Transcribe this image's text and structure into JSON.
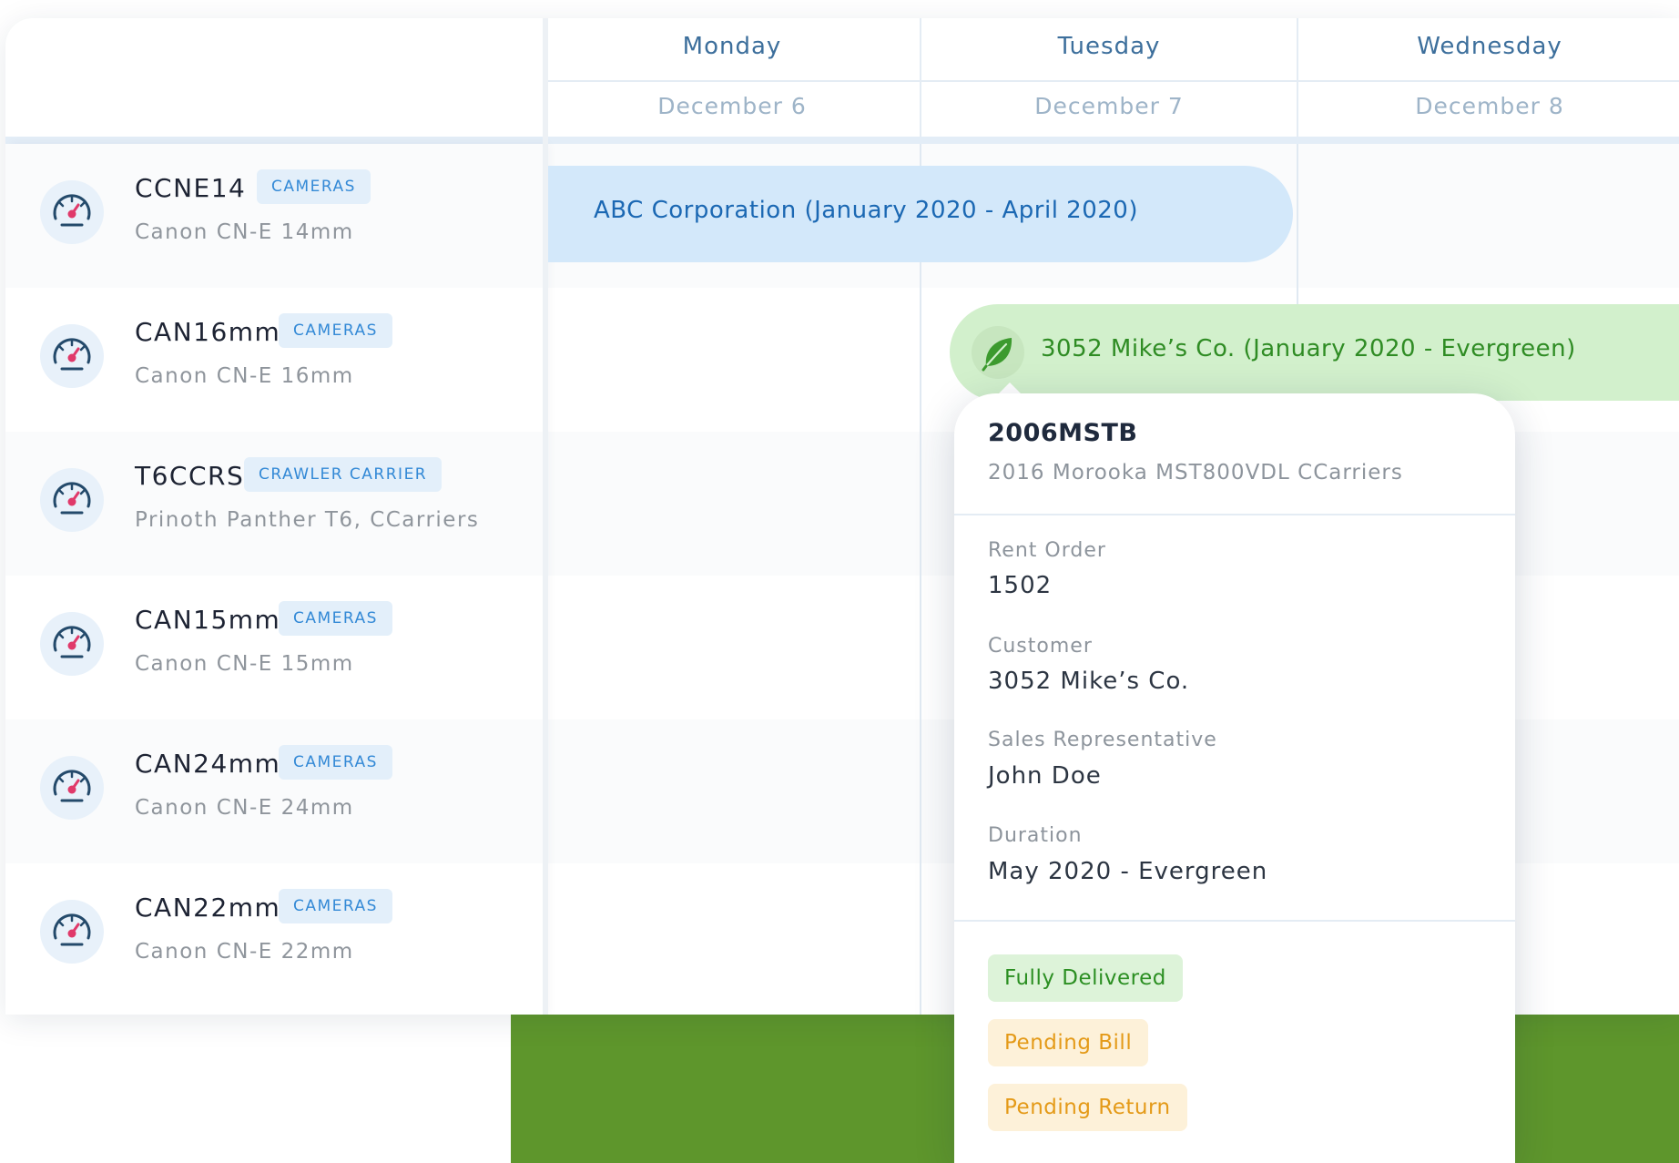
{
  "days": [
    {
      "name": "Monday",
      "date": "December 6"
    },
    {
      "name": "Tuesday",
      "date": "December 7"
    },
    {
      "name": "Wednesday",
      "date": "December 8"
    }
  ],
  "assets": [
    {
      "code": "CCNE14",
      "tag": "CAMERAS",
      "description": "Canon CN-E 14mm",
      "icon": "speedometer-icon"
    },
    {
      "code": "CAN16mm",
      "tag": "CAMERAS",
      "description": "Canon CN-E 16mm",
      "icon": "speedometer-icon"
    },
    {
      "code": "T6CCRS",
      "tag": "CRAWLER CARRIER",
      "description": "Prinoth Panther T6, CCarriers",
      "icon": "speedometer-icon"
    },
    {
      "code": "CAN15mm",
      "tag": "CAMERAS",
      "description": "Canon CN-E 15mm",
      "icon": "speedometer-icon"
    },
    {
      "code": "CAN24mm",
      "tag": "CAMERAS",
      "description": "Canon CN-E 24mm",
      "icon": "speedometer-icon"
    },
    {
      "code": "CAN22mm",
      "tag": "CAMERAS",
      "description": "Canon CN-E 22mm",
      "icon": "speedometer-icon"
    }
  ],
  "bookings": {
    "abc": {
      "label": "ABC Corporation  (January 2020 - April 2020)",
      "color": "#d3e8fa"
    },
    "mikes": {
      "label": "3052 Mike’s Co.  (January 2020 - Evergreen)",
      "color": "#d2f0cc",
      "icon": "leaf-icon"
    }
  },
  "popover": {
    "title": "2006MSTB",
    "subtitle": "2016 Morooka MST800VDL CCarriers",
    "fields": {
      "rent_order_label": "Rent Order",
      "rent_order_value": "1502",
      "customer_label": "Customer",
      "customer_value": "3052 Mike’s Co.",
      "sales_rep_label": "Sales Representative",
      "sales_rep_value": "John Doe",
      "duration_label": "Duration",
      "duration_value": "May 2020 - Evergreen"
    },
    "statuses": [
      "Fully Delivered",
      "Pending Bill",
      "Pending Return"
    ]
  },
  "colors": {
    "accent_blue": "#3389d6",
    "status_green": "#2b8f22",
    "status_orange": "#e49a18",
    "background_green": "#5e962c"
  }
}
